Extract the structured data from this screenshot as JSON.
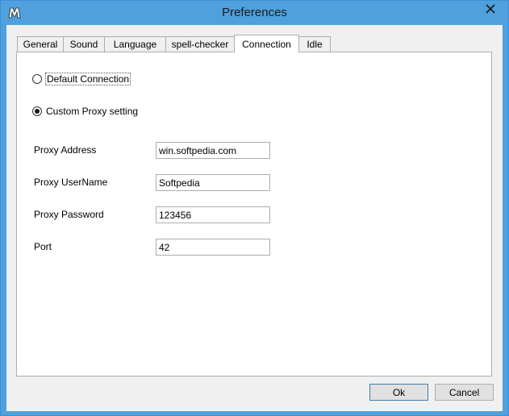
{
  "window": {
    "title": "Preferences"
  },
  "tabs": [
    {
      "label": "General"
    },
    {
      "label": "Sound"
    },
    {
      "label": "Language"
    },
    {
      "label": "spell-checker"
    },
    {
      "label": "Connection"
    },
    {
      "label": "Idle"
    }
  ],
  "active_tab": "Connection",
  "connection": {
    "default_option_label": "Default Connection",
    "custom_option_label": "Custom Proxy setting",
    "selected_option": "Custom Proxy setting",
    "fields": [
      {
        "label": "Proxy Address",
        "value": "win.softpedia.com"
      },
      {
        "label": "Proxy UserName",
        "value": "Softpedia"
      },
      {
        "label": "Proxy Password",
        "value": "123456"
      },
      {
        "label": "Port",
        "value": "42"
      }
    ]
  },
  "buttons": {
    "ok_label": "Ok",
    "cancel_label": "Cancel"
  },
  "colors": {
    "titlebar": "#4fa0dc",
    "client": "#f0f0f0",
    "panel": "#ffffff",
    "border": "#adadad"
  },
  "icons": {
    "app": "app-icon",
    "close": "close-icon"
  }
}
